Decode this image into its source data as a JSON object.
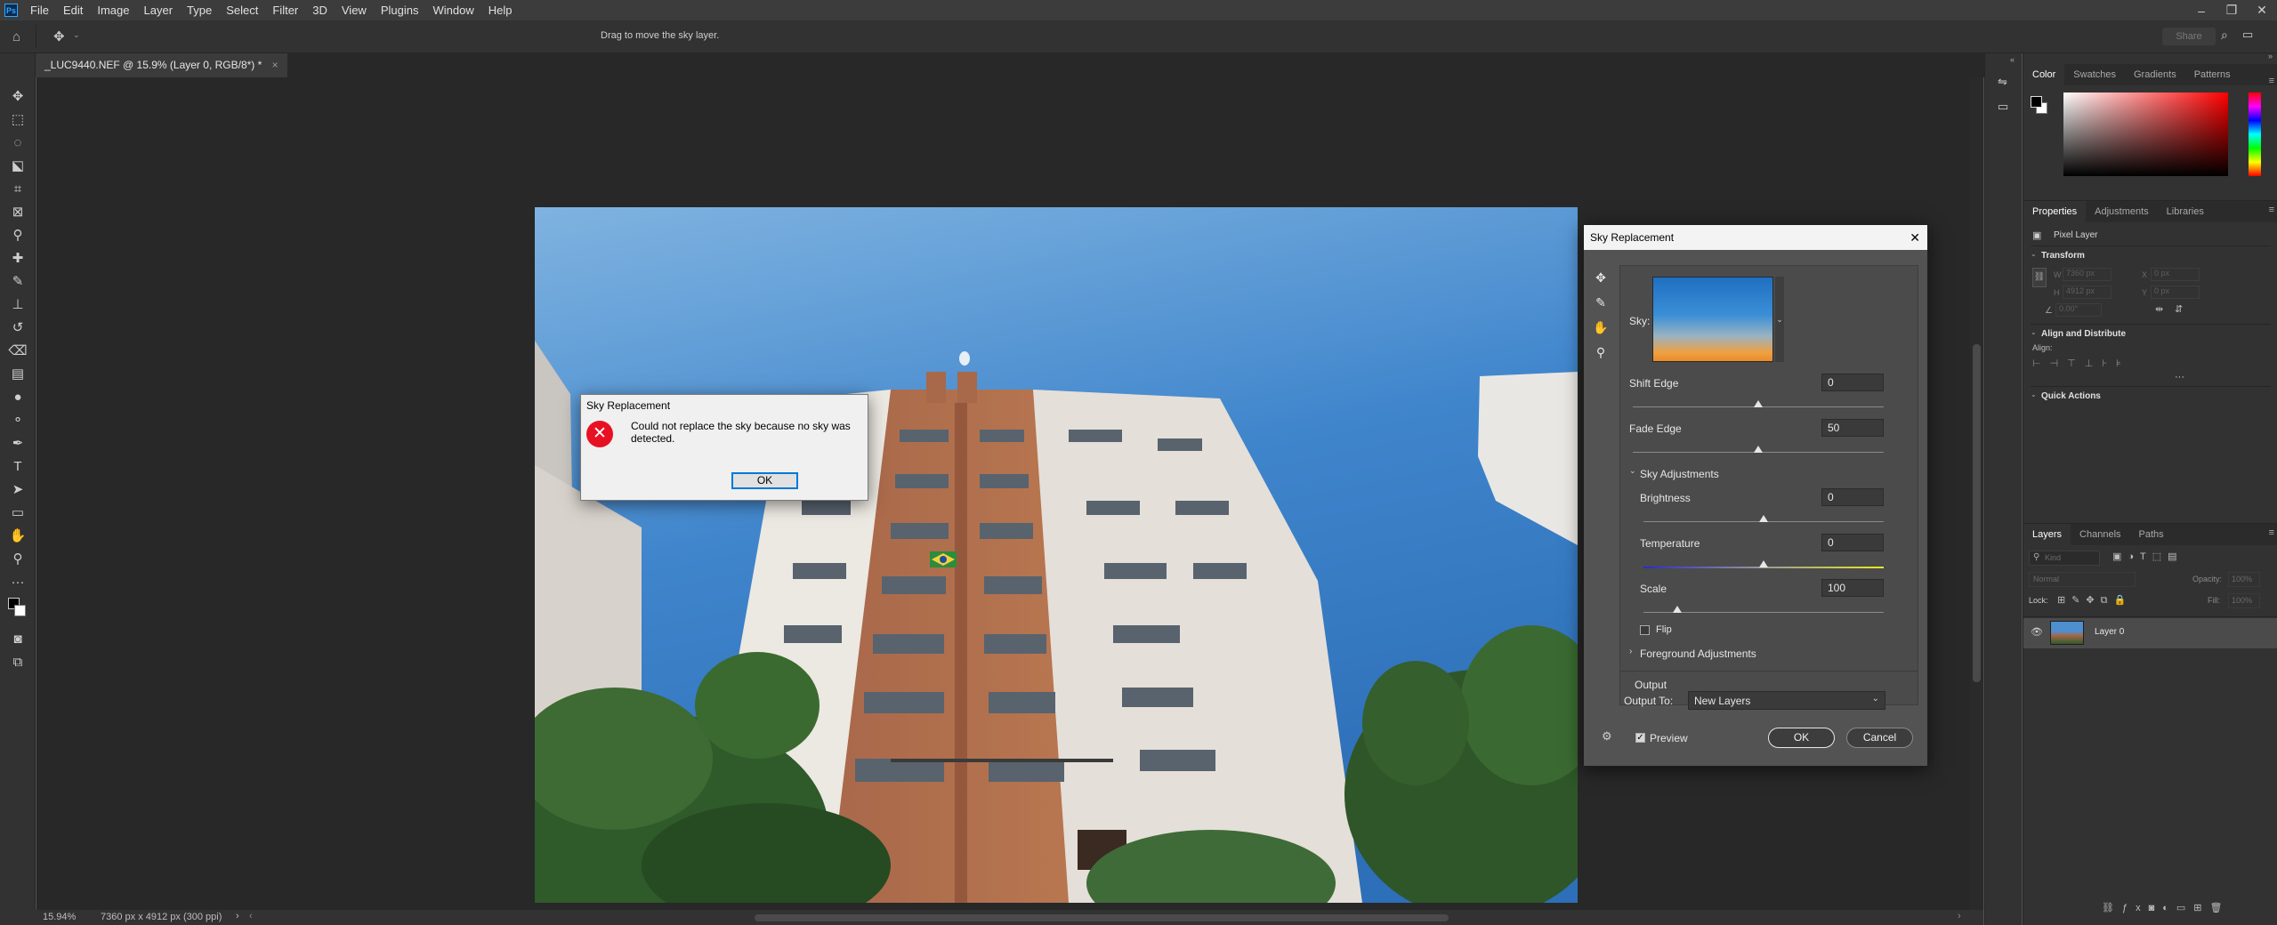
{
  "app": {
    "logo": "Ps"
  },
  "menu": [
    "File",
    "Edit",
    "Image",
    "Layer",
    "Type",
    "Select",
    "Filter",
    "3D",
    "View",
    "Plugins",
    "Window",
    "Help"
  ],
  "options_bar": {
    "hint": "Drag to move the sky layer.",
    "share_label": "Share"
  },
  "document": {
    "tab_title": "_LUC9440.NEF @ 15.9% (Layer 0, RGB/8*) *",
    "close": "×"
  },
  "status_bar": {
    "zoom": "15.94%",
    "info": "7360 px x 4912 px (300 ppi)",
    "arrow": "›"
  },
  "alert_dialog": {
    "title": "Sky Replacement",
    "message": "Could not replace the sky because no sky was detected.",
    "ok_label": "OK"
  },
  "sky_dialog": {
    "title": "Sky Replacement",
    "sky_label": "Sky:",
    "shift_edge": {
      "label": "Shift Edge",
      "value": "0",
      "level": 0.5
    },
    "fade_edge": {
      "label": "Fade Edge",
      "value": "50",
      "level": 0.5
    },
    "sky_adjustments_label": "Sky Adjustments",
    "brightness": {
      "label": "Brightness",
      "value": "0",
      "level": 0.5
    },
    "temperature": {
      "label": "Temperature",
      "value": "0",
      "level": 0.5
    },
    "scale": {
      "label": "Scale",
      "value": "100",
      "level": 0.14
    },
    "flip_label": "Flip",
    "foreground_label": "Foreground Adjustments",
    "output_label": "Output",
    "output_to_label": "Output To:",
    "output_to_value": "New Layers",
    "preview_label": "Preview",
    "ok_label": "OK",
    "cancel_label": "Cancel"
  },
  "color_panel": {
    "tabs": [
      "Color",
      "Swatches",
      "Gradients",
      "Patterns"
    ]
  },
  "properties_panel": {
    "tabs": [
      "Properties",
      "Adjustments",
      "Libraries"
    ],
    "layer_type": "Pixel Layer",
    "transform_label": "Transform",
    "w_label": "W",
    "w_value": "7360 px",
    "x_label": "X",
    "x_value": "0 px",
    "h_label": "H",
    "h_value": "4912 px",
    "y_label": "Y",
    "y_value": "0 px",
    "angle_value": "0.00°",
    "align_label": "Align and Distribute",
    "align_sub": "Align:",
    "quick_actions_label": "Quick Actions"
  },
  "layers_panel": {
    "tabs": [
      "Layers",
      "Channels",
      "Paths"
    ],
    "search_placeholder": "Kind",
    "blend_mode": "Normal",
    "opacity_label": "Opacity:",
    "opacity_value": "100%",
    "lock_label": "Lock:",
    "fill_label": "Fill:",
    "fill_value": "100%",
    "layers": [
      {
        "name": "Layer 0"
      }
    ]
  },
  "colors": {
    "accent": "#0078d7",
    "error": "#e81123",
    "panel": "#323232",
    "canvas": "#282828"
  }
}
